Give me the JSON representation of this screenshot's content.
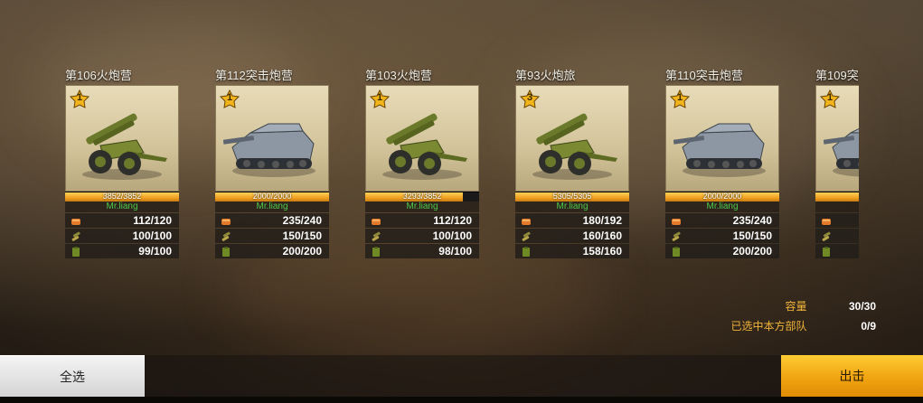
{
  "units": [
    {
      "name": "第106火炮营",
      "rank": "1",
      "type": "howitzer",
      "hp": "3852/3852",
      "hp_fraction": 1.0,
      "owner": "Mr.liang",
      "food": "112/120",
      "ammo": "100/100",
      "fuel": "99/100"
    },
    {
      "name": "第112突击炮营",
      "rank": "1",
      "type": "assault-gun",
      "hp": "2000/2000",
      "hp_fraction": 1.0,
      "owner": "Mr.liang",
      "food": "235/240",
      "ammo": "150/150",
      "fuel": "200/200"
    },
    {
      "name": "第103火炮营",
      "rank": "1",
      "type": "howitzer",
      "hp": "3293/3852",
      "hp_fraction": 0.855,
      "owner": "Mr.liang",
      "food": "112/120",
      "ammo": "100/100",
      "fuel": "98/100"
    },
    {
      "name": "第93火炮旅",
      "rank": "3",
      "type": "howitzer",
      "hp": "5305/5305",
      "hp_fraction": 1.0,
      "owner": "Mr.liang",
      "food": "180/192",
      "ammo": "160/160",
      "fuel": "158/160"
    },
    {
      "name": "第110突击炮营",
      "rank": "1",
      "type": "assault-gun",
      "hp": "2000/2000",
      "hp_fraction": 1.0,
      "owner": "Mr.liang",
      "food": "235/240",
      "ammo": "150/150",
      "fuel": "200/200"
    },
    {
      "name": "第109突",
      "rank": "1",
      "type": "assault-gun",
      "hp": "2",
      "hp_fraction": 1.0,
      "owner": "M",
      "food": "",
      "ammo": "",
      "fuel": ""
    }
  ],
  "stats": {
    "capacity_label": "容量",
    "capacity_value": "30/30",
    "selected_label": "已选中本方部队",
    "selected_value": "0/9"
  },
  "buttons": {
    "select_all": "全选",
    "deploy": "出击"
  },
  "colors": {
    "accent": "#f0a412",
    "owner_text": "#4ec94b",
    "stat_label": "#f0b43a"
  },
  "icons": {
    "food": "bread-icon",
    "ammo": "ammo-icon",
    "fuel": "fuel-can-icon",
    "rank": "star-rank-badge-icon"
  }
}
